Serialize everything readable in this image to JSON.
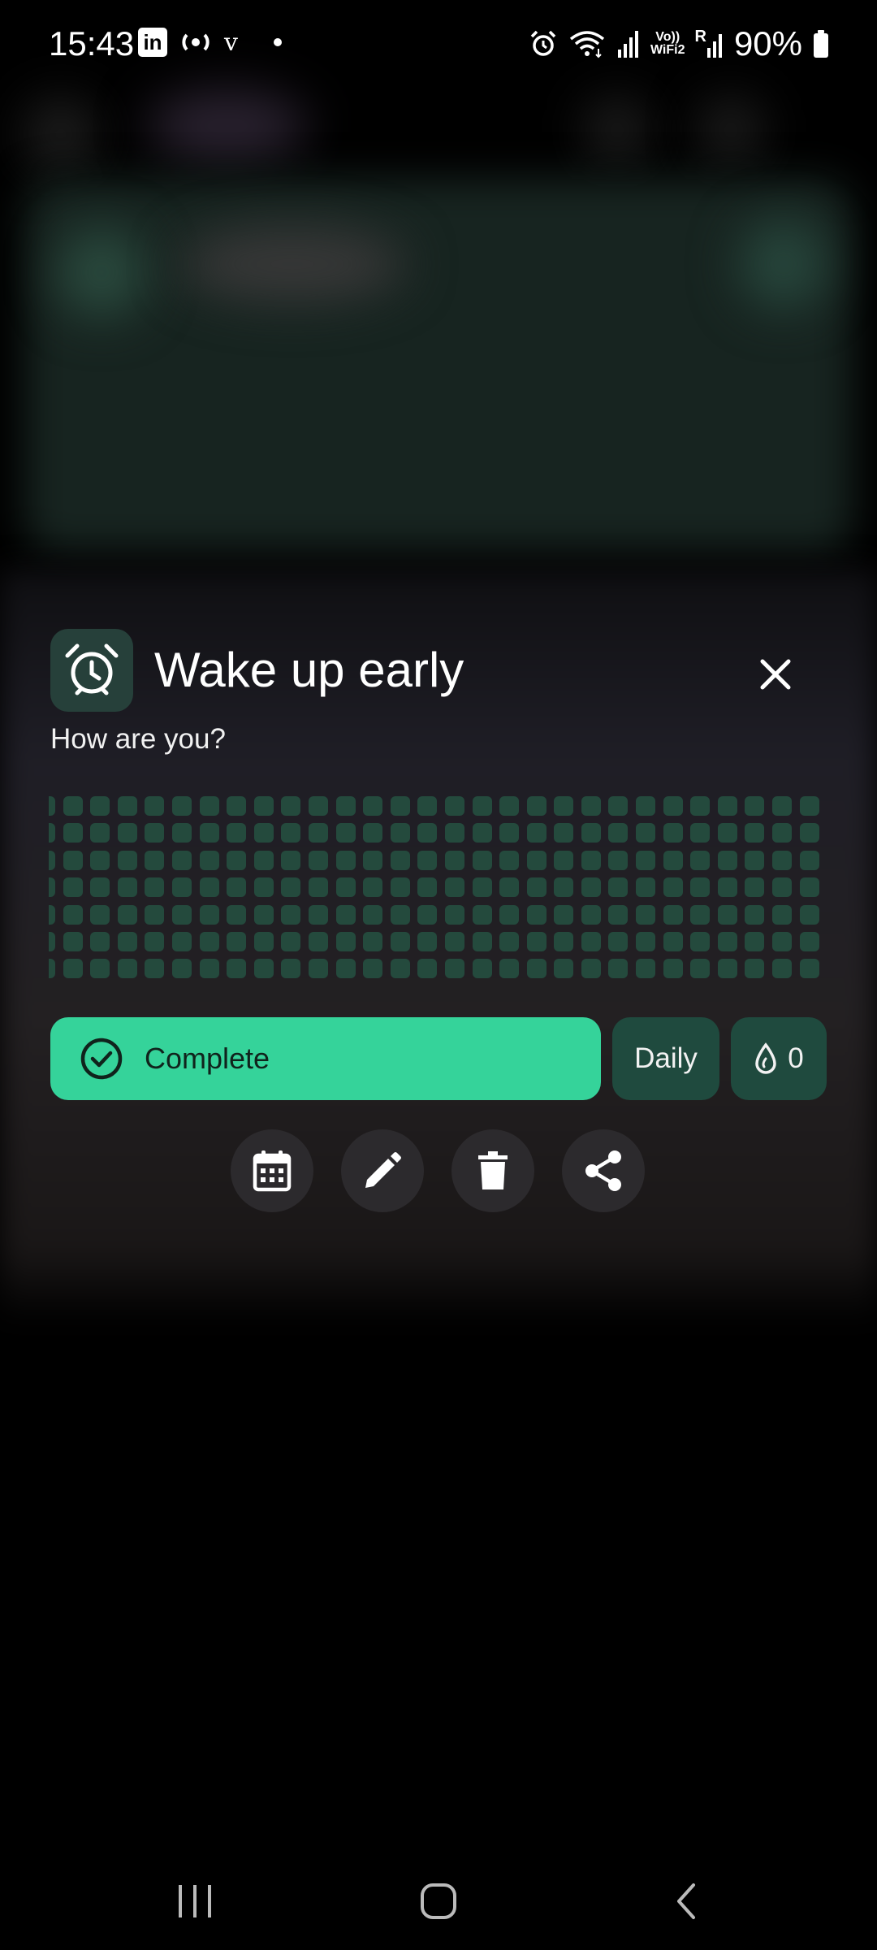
{
  "status_bar": {
    "time": "15:43",
    "battery_percent": "90%",
    "left_icons": [
      "linkedin-icon",
      "broadcast-icon",
      "v-icon",
      "dot-icon"
    ],
    "right_icons": [
      "alarm-icon",
      "wifi-icon",
      "signal-icon",
      "volte-wifi-icon",
      "roaming-signal-icon",
      "battery-icon"
    ],
    "linkedin_glyph": "in",
    "v_glyph": "v",
    "volte_text_top": "Vo))",
    "volte_text_bottom": "WiFi2",
    "roaming_text": "R"
  },
  "habit": {
    "icon": "alarm-clock-icon",
    "title": "Wake up early",
    "subtitle": "How are you?",
    "heatmap": {
      "rows": 7,
      "columns": 30,
      "completed_days": 0
    }
  },
  "buttons": {
    "complete_label": "Complete",
    "frequency_label": "Daily",
    "streak_count": "0"
  },
  "actions": [
    {
      "name": "calendar-button",
      "icon": "calendar-icon"
    },
    {
      "name": "edit-button",
      "icon": "pencil-icon"
    },
    {
      "name": "delete-button",
      "icon": "trash-icon"
    },
    {
      "name": "share-button",
      "icon": "share-icon"
    }
  ],
  "colors": {
    "accent": "#35d39a",
    "heatmap_empty": "#244a3d",
    "chip_bg": "#1f4a3e",
    "icon_box_bg": "#26403a"
  }
}
